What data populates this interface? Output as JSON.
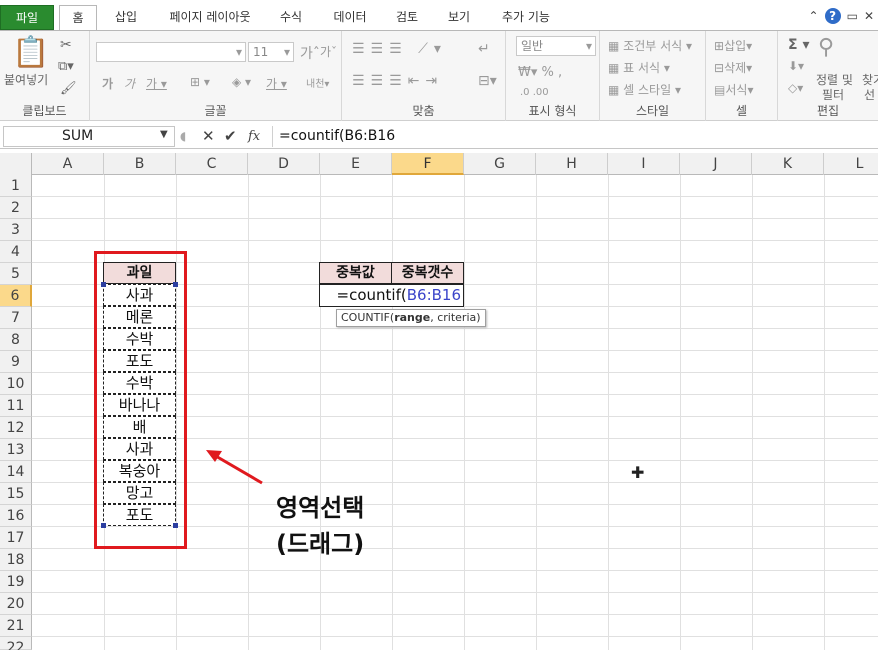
{
  "tabs": [
    "파일",
    "홈",
    "삽입",
    "페이지 레이아웃",
    "수식",
    "데이터",
    "검토",
    "보기",
    "추가 기능"
  ],
  "ribbon": {
    "groups": [
      "클립보드",
      "글꼴",
      "맞춤",
      "표시 형식",
      "스타일",
      "셀",
      "편집"
    ],
    "paste_label": "붙여넣기",
    "font_size": "11",
    "number_format": "일반",
    "cond_format": "조건부 서식",
    "table_format": "표 서식",
    "cell_style": "셀 스타일",
    "insert": "삽입",
    "delete": "삭제",
    "format": "서식",
    "sort_filter_1": "정렬 및",
    "sort_filter_2": "필터",
    "find_1": "찾기",
    "find_2": "선"
  },
  "formula_bar": {
    "name_box": "SUM",
    "formula": "=countif(B6:B16"
  },
  "columns": [
    "A",
    "B",
    "C",
    "D",
    "E",
    "F",
    "G",
    "H",
    "I",
    "J",
    "K",
    "L"
  ],
  "rows": [
    "1",
    "2",
    "3",
    "4",
    "5",
    "6",
    "7",
    "8",
    "9",
    "10",
    "11",
    "12",
    "13",
    "14",
    "15",
    "16",
    "17",
    "18",
    "19",
    "20",
    "21",
    "22"
  ],
  "sheet": {
    "fruit_header": "과일",
    "fruits": [
      "사과",
      "메론",
      "수박",
      "포도",
      "수박",
      "바나나",
      "배",
      "사과",
      "복숭아",
      "망고",
      "포도"
    ],
    "dup_value_header": "중복값",
    "dup_count_header": "중복갯수",
    "edit_prefix": "=countif(",
    "edit_ref": "B6:B16",
    "tooltip_fn": "COUNTIF(",
    "tooltip_arg1": "range",
    "tooltip_rest": ", criteria)"
  },
  "annotation": {
    "line1": "영역선택",
    "line2": "(드래그)"
  },
  "colors": {
    "accent_green": "#2a8b2f",
    "highlight_red": "#e0191e",
    "header_fill": "#f2dcdb"
  }
}
